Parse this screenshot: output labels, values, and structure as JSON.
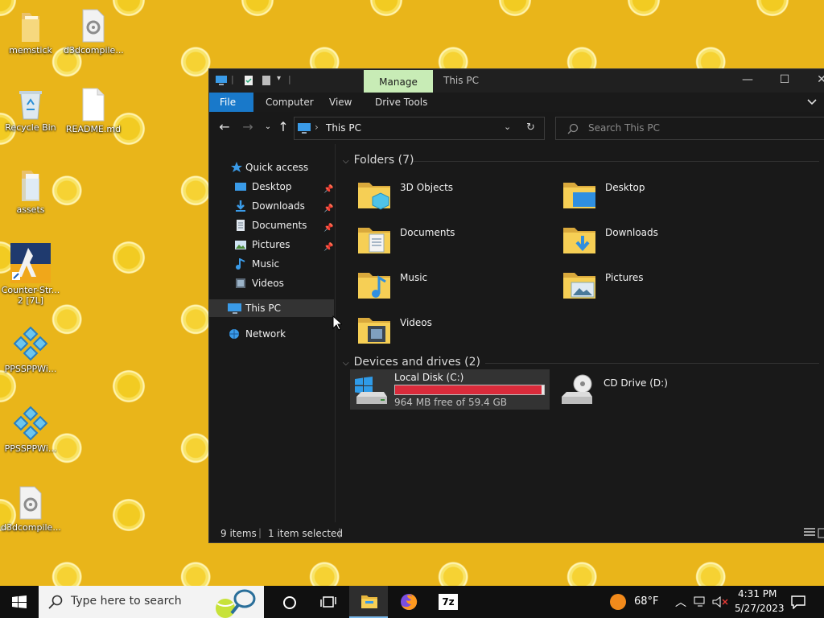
{
  "desktop": {
    "icons": [
      {
        "label": "memstick"
      },
      {
        "label": "d3dcompile..."
      },
      {
        "label": "Recycle Bin"
      },
      {
        "label": "README.md"
      },
      {
        "label": "assets"
      },
      {
        "label": "Counter-Str... 2 [7L]"
      },
      {
        "label": "PPSSPPWi..."
      },
      {
        "label": "PPSSPPWi..."
      },
      {
        "label": "d3dcompile..."
      }
    ]
  },
  "window": {
    "title": "This PC",
    "manage_tab": "Manage",
    "ribbon_tabs": [
      "File",
      "Computer",
      "View",
      "Drive Tools"
    ],
    "caption": {
      "minimize": "—",
      "maximize": "☐",
      "close": "✕"
    },
    "address": {
      "path": "This PC",
      "separator": "›"
    },
    "search_placeholder": "Search This PC",
    "nav": {
      "quick_access": "Quick access",
      "items": [
        {
          "label": "Desktop",
          "pinned": true
        },
        {
          "label": "Downloads",
          "pinned": true
        },
        {
          "label": "Documents",
          "pinned": true
        },
        {
          "label": "Pictures",
          "pinned": true
        },
        {
          "label": "Music",
          "pinned": false
        },
        {
          "label": "Videos",
          "pinned": false
        }
      ],
      "this_pc": "This PC",
      "network": "Network"
    },
    "folders_header": "Folders (7)",
    "folders": [
      "3D Objects",
      "Desktop",
      "Documents",
      "Downloads",
      "Music",
      "Pictures",
      "Videos"
    ],
    "drives_header": "Devices and drives (2)",
    "drives": [
      {
        "name": "Local Disk (C:)",
        "free": "964 MB free of 59.4 GB",
        "used_fraction": 0.984,
        "bar_color": "#da2b3b"
      },
      {
        "name": "CD Drive (D:)"
      }
    ],
    "status": {
      "items": "9 items",
      "selected": "1 item selected"
    }
  },
  "taskbar": {
    "search_placeholder": "Type here to search",
    "weather": "68°F",
    "time": "4:31 PM",
    "date": "5/27/2023"
  },
  "colors": {
    "accent": "#1979ca",
    "manage_tab": "#c8ecb6",
    "drive_bar": "#da2b3b",
    "folder": "#f6cf55"
  }
}
